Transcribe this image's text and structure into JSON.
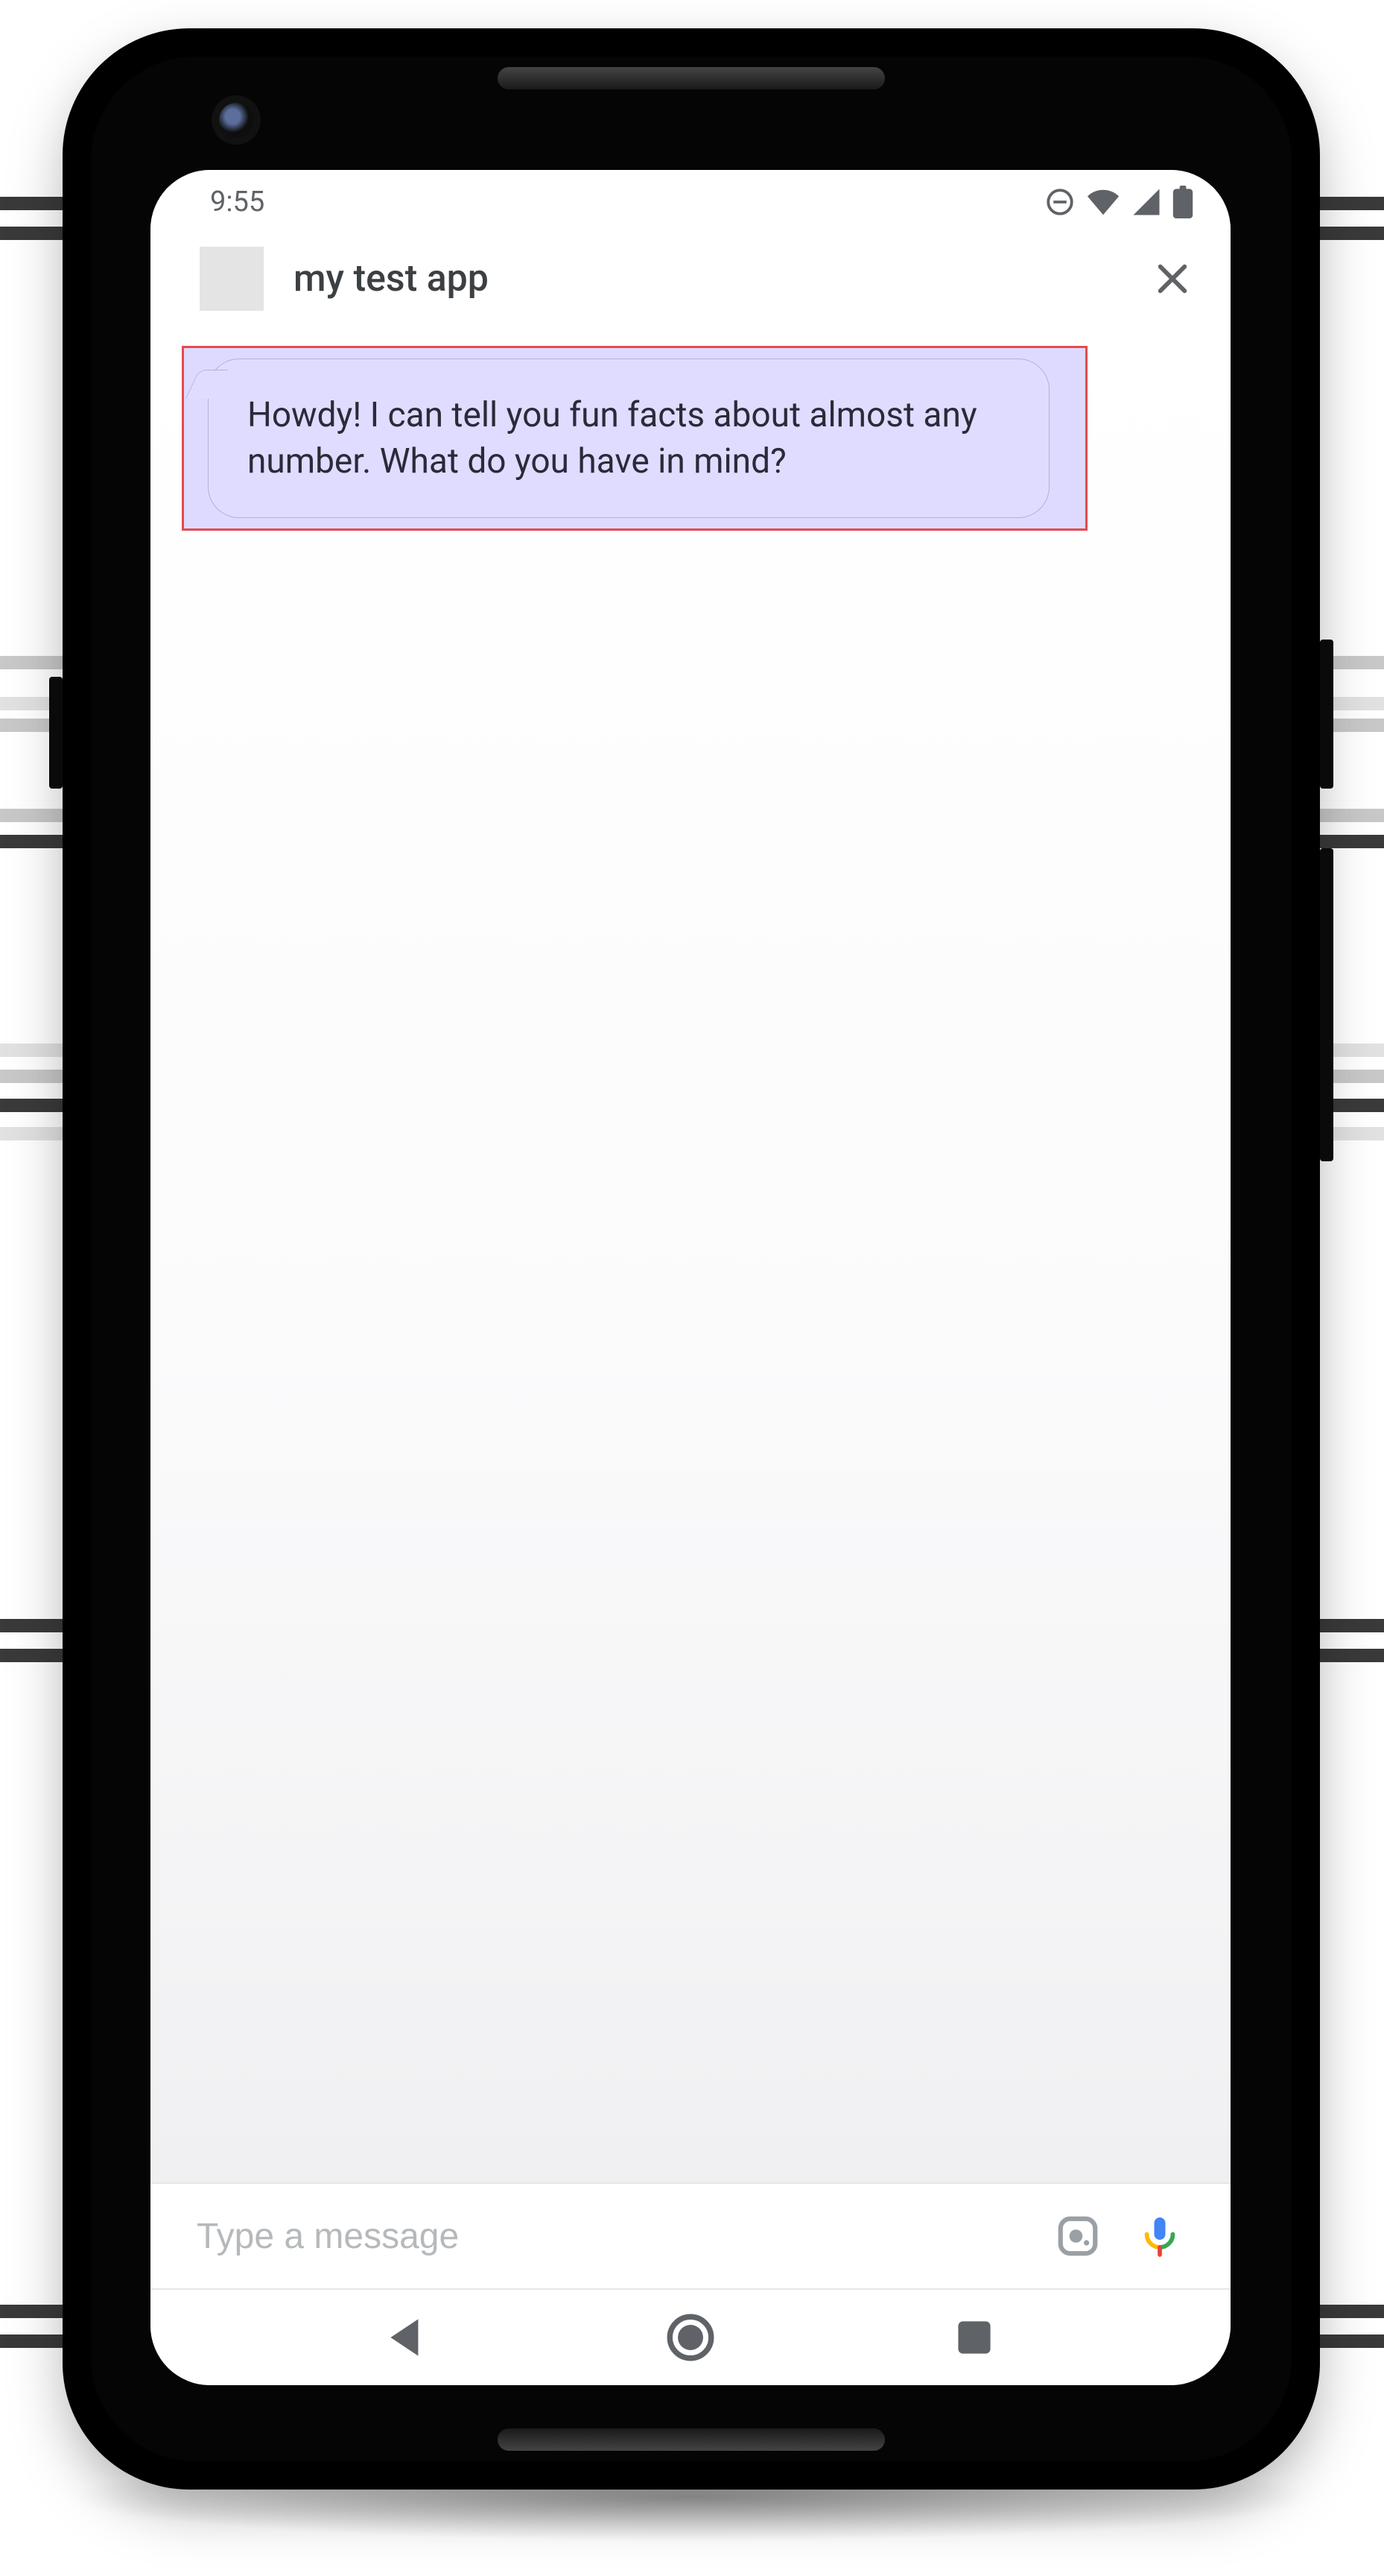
{
  "status": {
    "time": "9:55"
  },
  "header": {
    "app_title": "my test app"
  },
  "conversation": {
    "bot_message": "Howdy! I can tell you fun facts about almost any number. What do you have in mind?"
  },
  "input": {
    "placeholder": "Type a message"
  }
}
